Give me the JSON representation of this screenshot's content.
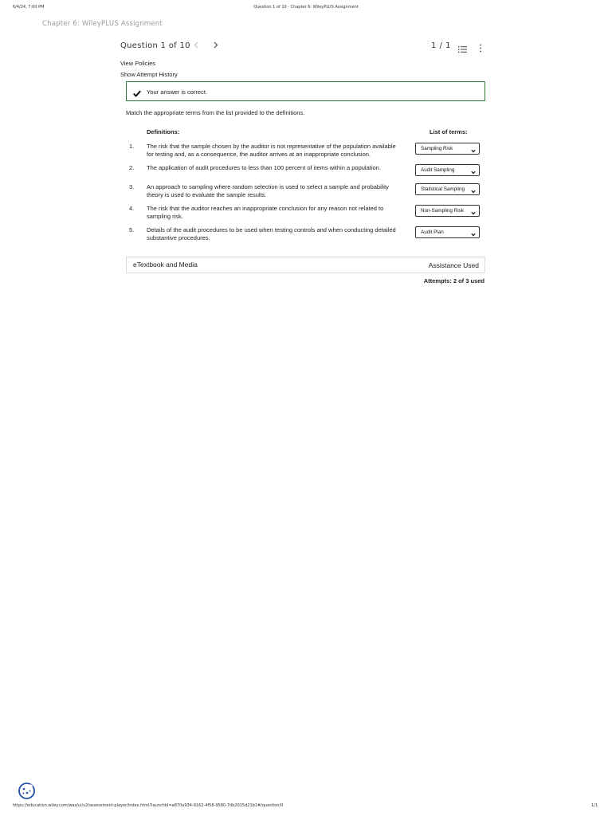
{
  "print_header": {
    "datetime": "6/4/24, 7:00 PM",
    "page_title": "Question 1 of 10 - Chapter 6: WileyPLUS Assignment"
  },
  "print_footer": {
    "url": "https://education.wiley.com/was/ui/v2/assessment-player/index.html?launchId=a870a934-9162-4f58-9580-7db2015d21b1#/question/0",
    "page_count": "1/1"
  },
  "chapter_title": "Chapter 6: WileyPLUS Assignment",
  "question_bar": {
    "title": "Question 1 of 10",
    "prev_icon": "chevron-left-icon",
    "next_icon": "chevron-right-icon",
    "pager": "1 / 1",
    "list_icon": "list-icon",
    "more_icon": "more-vertical-icon"
  },
  "links": {
    "view_policies": "View Policies",
    "show_attempt_history": "Show Attempt History"
  },
  "feedback": {
    "icon": "checkmark-icon",
    "message": "Your answer is correct.",
    "border_color": "#2e7d32"
  },
  "instruction": "Match the appropriate terms from the list provided to the definitions.",
  "headers": {
    "definitions": "Definitions:",
    "terms": "List of terms:"
  },
  "questions": [
    {
      "number": "1.",
      "definition": "The risk that the sample chosen by the auditor is not representative of the population available for testing and, as a consequence, the auditor arrives at an inappropriate conclusion.",
      "selected": "Sampling Risk"
    },
    {
      "number": "2.",
      "definition": "The application of audit procedures to less than 100 percent of items within a population.",
      "selected": "Audit Sampling"
    },
    {
      "number": "3.",
      "definition": "An approach to sampling where random selection is used to select a sample and probability theory is used to evaluate the sample results.",
      "selected": "Statistical Sampling"
    },
    {
      "number": "4.",
      "definition": "The risk that the auditor reaches an inappropriate conclusion for any reason not related to sampling risk.",
      "selected": "Non-Sampling Risk"
    },
    {
      "number": "5.",
      "definition": "Details of the audit procedures to be used when testing controls and when conducting detailed substantive procedures.",
      "selected": "Audit Plan"
    }
  ],
  "etextbook": {
    "label": "eTextbook and Media",
    "assistance": "Assistance Used"
  },
  "attempts": "Attempts: 2 of 3 used",
  "cookie_icon": "cookie-icon"
}
